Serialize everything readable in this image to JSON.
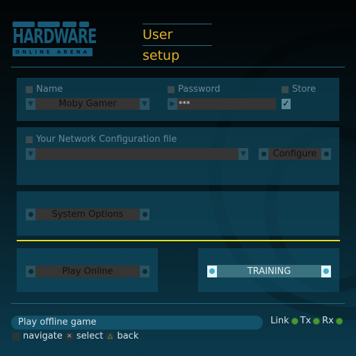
{
  "logo": {
    "main": "HARDWARE",
    "sub": "ONLINE ARENA"
  },
  "title": "User setup",
  "user": {
    "name_label": "Name",
    "name_value": "Moby Gamer",
    "password_label": "Password",
    "password_value": "***",
    "store_label": "Store",
    "store_checked": true,
    "checkmark": "✓"
  },
  "network": {
    "label": "Your Network Configuration file",
    "value": "",
    "configure_label": "Configure"
  },
  "system_options_label": "System Options",
  "play_online_label": "Play Online",
  "training_label": "TRAINING",
  "status": {
    "message": "Play offline game",
    "link": "Link",
    "tx": "Tx",
    "rx": "Rx"
  },
  "hints": {
    "navigate": "navigate",
    "select": "select",
    "back": "back",
    "x_glyph": "✕",
    "tri_glyph": "△"
  },
  "glyphs": {
    "down": "▼",
    "right": "▶"
  }
}
